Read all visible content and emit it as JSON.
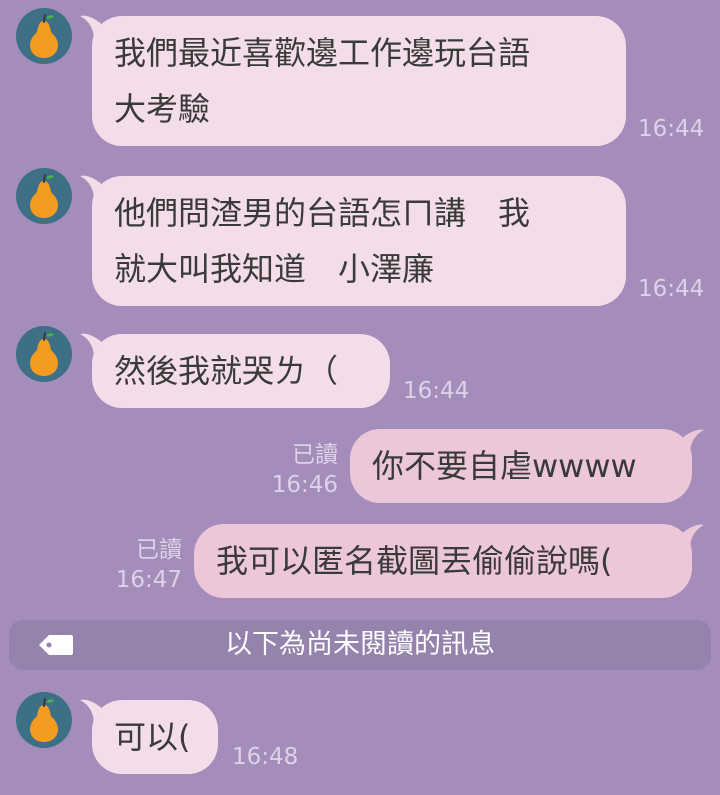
{
  "colors": {
    "background": "#a48dba",
    "incoming_bubble": "#f3dde8",
    "outgoing_bubble": "#ecc7d8",
    "avatar_bg": "#3d6f86",
    "avatar_pear": "#f39c1f",
    "divider_bg": "#9582ad"
  },
  "avatar_icon": "pear-icon",
  "messages": [
    {
      "direction": "in",
      "text_lines": [
        "我們最近喜歡邊工作邊玩台語",
        "大考驗"
      ],
      "time": "16:44"
    },
    {
      "direction": "in",
      "text_lines": [
        "他們問渣男的台語怎ㄇ講　我",
        "就大叫我知道　小澤廉"
      ],
      "time": "16:44"
    },
    {
      "direction": "in",
      "text_lines": [
        "然後我就哭ㄌ（"
      ],
      "time": "16:44"
    },
    {
      "direction": "out",
      "text_lines": [
        "你不要自虐wwww"
      ],
      "read": "已讀",
      "time": "16:46"
    },
    {
      "direction": "out",
      "text_lines": [
        "我可以匿名截圖丟偷偷說嗎("
      ],
      "read": "已讀",
      "time": "16:47"
    },
    {
      "direction": "in",
      "text_lines": [
        "可以("
      ],
      "time": "16:48"
    }
  ],
  "unread_divider": {
    "icon": "tag-icon",
    "label": "以下為尚未閱讀的訊息"
  }
}
